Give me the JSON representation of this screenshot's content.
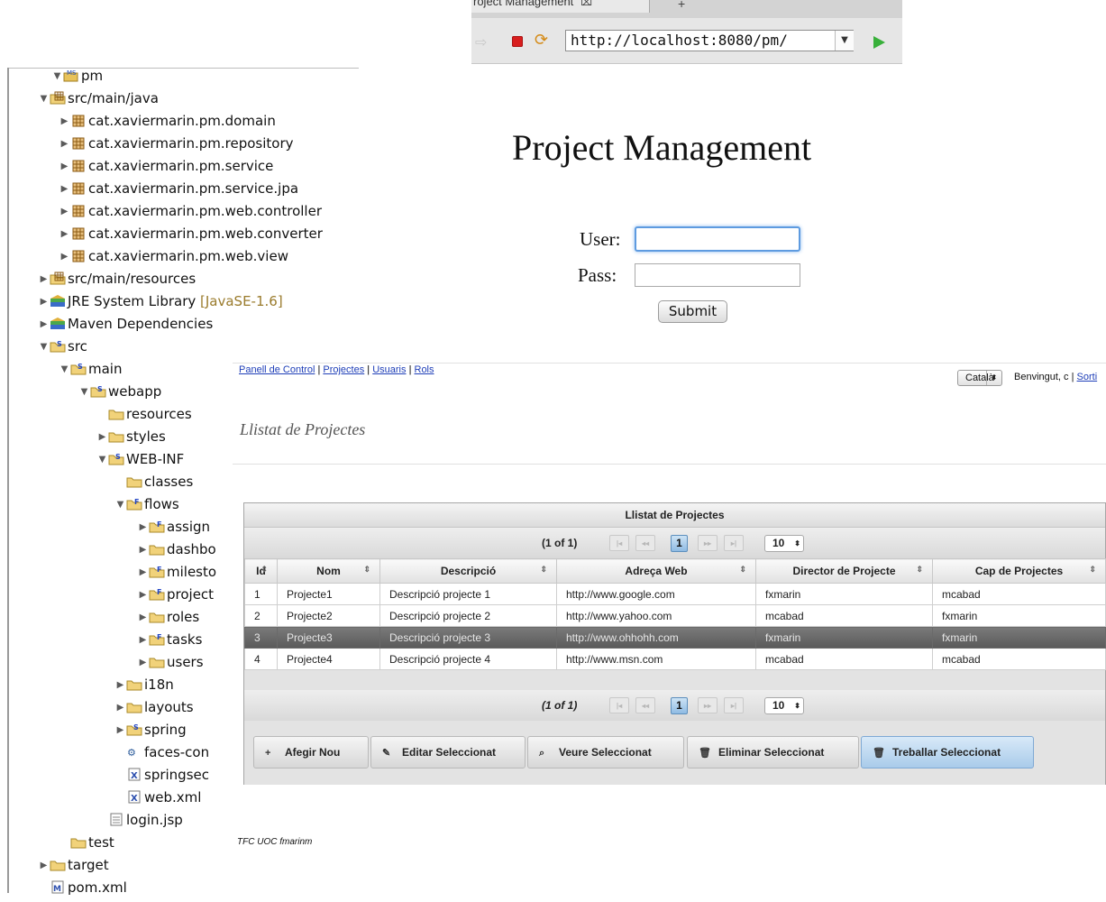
{
  "browser": {
    "tab_title": "roject Management",
    "tab_close": "⌧",
    "new_tab": "+",
    "url": "http://localhost:8080/pm/",
    "dropdown_arrow": "▼",
    "icons": {
      "back": "arrow-right-icon",
      "stop": "stop-icon",
      "reload": "reload-icon",
      "go": "go-icon"
    }
  },
  "tree": {
    "items": [
      {
        "label": "pm",
        "extra": "",
        "icon": "maven-project-icon",
        "expanded": true,
        "twisty": "▼"
      },
      {
        "label": "src/main/java",
        "extra": "",
        "icon": "source-folder-icon",
        "twisty": "▼"
      },
      {
        "label": "cat.xaviermarin.pm.domain",
        "extra": "",
        "icon": "package-icon",
        "twisty": "▶"
      },
      {
        "label": "cat.xaviermarin.pm.repository",
        "extra": "",
        "icon": "package-icon",
        "twisty": "▶"
      },
      {
        "label": "cat.xaviermarin.pm.service",
        "extra": "",
        "icon": "package-icon",
        "twisty": "▶"
      },
      {
        "label": "cat.xaviermarin.pm.service.jpa",
        "extra": "",
        "icon": "package-icon",
        "twisty": "▶"
      },
      {
        "label": "cat.xaviermarin.pm.web.controller",
        "extra": "",
        "icon": "package-icon",
        "twisty": "▶"
      },
      {
        "label": "cat.xaviermarin.pm.web.converter",
        "extra": "",
        "icon": "package-icon",
        "twisty": "▶"
      },
      {
        "label": "cat.xaviermarin.pm.web.view",
        "extra": "",
        "icon": "package-icon",
        "twisty": "▶"
      },
      {
        "label": "src/main/resources",
        "extra": "",
        "icon": "source-folder-icon",
        "twisty": "▶"
      },
      {
        "label": "JRE System Library ",
        "extra": "[JavaSE-1.6]",
        "icon": "library-icon",
        "twisty": "▶"
      },
      {
        "label": "Maven Dependencies",
        "extra": "",
        "icon": "library-icon",
        "twisty": "▶"
      },
      {
        "label": "src",
        "extra": "",
        "icon": "spring-folder-icon",
        "twisty": "▼"
      },
      {
        "label": "main",
        "extra": "",
        "icon": "spring-folder-icon",
        "twisty": "▼"
      },
      {
        "label": "webapp",
        "extra": "",
        "icon": "spring-folder-icon",
        "twisty": "▼"
      },
      {
        "label": "resources",
        "extra": "",
        "icon": "folder-icon",
        "twisty": ""
      },
      {
        "label": "styles",
        "extra": "",
        "icon": "folder-icon",
        "twisty": "▶"
      },
      {
        "label": "WEB-INF",
        "extra": "",
        "icon": "spring-folder-icon",
        "twisty": "▼"
      },
      {
        "label": "classes",
        "extra": "",
        "icon": "folder-icon",
        "twisty": ""
      },
      {
        "label": "flows",
        "extra": "",
        "icon": "flow-folder-icon",
        "twisty": "▼"
      },
      {
        "label": "assign",
        "extra": "",
        "icon": "flow-folder-icon",
        "twisty": "▶"
      },
      {
        "label": "dashbo",
        "extra": "",
        "icon": "folder-icon",
        "twisty": "▶"
      },
      {
        "label": "milesto",
        "extra": "",
        "icon": "flow-folder-icon",
        "twisty": "▶"
      },
      {
        "label": "project",
        "extra": "",
        "icon": "flow-folder-icon",
        "twisty": "▶"
      },
      {
        "label": "roles",
        "extra": "",
        "icon": "folder-icon",
        "twisty": "▶"
      },
      {
        "label": "tasks",
        "extra": "",
        "icon": "flow-folder-icon",
        "twisty": "▶"
      },
      {
        "label": "users",
        "extra": "",
        "icon": "folder-icon",
        "twisty": "▶"
      },
      {
        "label": "i18n",
        "extra": "",
        "icon": "folder-icon",
        "twisty": "▶"
      },
      {
        "label": "layouts",
        "extra": "",
        "icon": "folder-icon",
        "twisty": "▶"
      },
      {
        "label": "spring",
        "extra": "",
        "icon": "spring-folder-icon",
        "twisty": "▶"
      },
      {
        "label": "faces-con",
        "extra": "",
        "icon": "faces-config-icon",
        "twisty": ""
      },
      {
        "label": "springsec",
        "extra": "",
        "icon": "xml-file-icon",
        "twisty": ""
      },
      {
        "label": "web.xml",
        "extra": "",
        "icon": "xml-file-icon",
        "twisty": ""
      },
      {
        "label": "login.jsp",
        "extra": "",
        "icon": "jsp-file-icon",
        "twisty": ""
      },
      {
        "label": "test",
        "extra": "",
        "icon": "folder-icon",
        "twisty": ""
      },
      {
        "label": "target",
        "extra": "",
        "icon": "folder-icon",
        "twisty": "▶"
      },
      {
        "label": "pom.xml",
        "extra": "",
        "icon": "maven-pom-icon",
        "twisty": ""
      }
    ]
  },
  "login": {
    "title": "Project Management",
    "user_label": "User:",
    "pass_label": "Pass:",
    "user_value": "",
    "pass_value": "",
    "submit_label": "Submit"
  },
  "app": {
    "nav": {
      "links": [
        "Panell de Control",
        "Projectes",
        "Usuaris",
        "Rols"
      ],
      "separator": " | "
    },
    "language": "Català",
    "welcome_text": "Benvingut, c",
    "logout_sep": " | ",
    "logout_label": "Sorti",
    "heading": "Llistat de Projectes",
    "grid": {
      "caption": "Llistat de Projectes",
      "paginator": {
        "current_page_report": "(1 of 1)",
        "first": "|◂",
        "prev": "◂◂",
        "page": "1",
        "next": "▸▸",
        "last": "▸|",
        "rows_per_page": "10",
        "rows_arrow": "⬍"
      },
      "columns": [
        "Id",
        "Nom",
        "Descripció",
        "Adreça Web",
        "Director de Projecte",
        "Cap de Projectes"
      ],
      "sort_icon": "⇕",
      "rows": [
        [
          "1",
          "Projecte1",
          "Descripció projecte 1",
          "http://www.google.com",
          "fxmarin",
          "mcabad"
        ],
        [
          "2",
          "Projecte2",
          "Descripció projecte 2",
          "http://www.yahoo.com",
          "mcabad",
          "fxmarin"
        ],
        [
          "3",
          "Projecte3",
          "Descripció projecte 3",
          "http://www.ohhohh.com",
          "fxmarin",
          "fxmarin"
        ],
        [
          "4",
          "Projecte4",
          "Descripció projecte 4",
          "http://www.msn.com",
          "mcabad",
          "mcabad"
        ]
      ],
      "selected_row": 2,
      "buttons": [
        {
          "label": "Afegir Nou",
          "icon": "plus-icon",
          "glyph": "+"
        },
        {
          "label": "Editar Seleccionat",
          "icon": "edit-icon",
          "glyph": "✎"
        },
        {
          "label": "Veure Seleccionat",
          "icon": "search-icon",
          "glyph": "⌕"
        },
        {
          "label": "Eliminar Seleccionat",
          "icon": "trash-icon",
          "glyph": "🗑"
        },
        {
          "label": "Treballar Seleccionat",
          "icon": "trash-icon",
          "glyph": "🗑"
        }
      ]
    },
    "footer": "TFC UOC fmarinm"
  },
  "colors": {
    "link": "#1f3fb8",
    "selected_row": "#666666",
    "focus_ring": "#5e9be0",
    "active_button": "#a9cbea"
  }
}
